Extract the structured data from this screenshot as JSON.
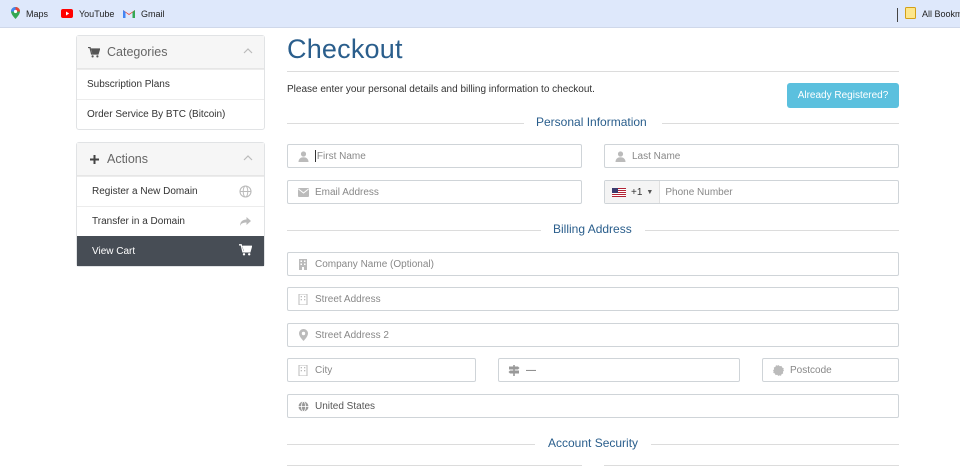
{
  "bookmarks": {
    "items": [
      {
        "label": "Maps",
        "icon": "maps-pin-icon"
      },
      {
        "label": "YouTube",
        "icon": "youtube-icon"
      },
      {
        "label": "Gmail",
        "icon": "gmail-icon"
      }
    ],
    "all_bookmarks": "All Bookm"
  },
  "sidebar": {
    "categories": {
      "title": "Categories",
      "items": [
        "Subscription Plans",
        "Order Service By BTC (Bitcoin)"
      ]
    },
    "actions": {
      "title": "Actions",
      "items": [
        "Register a New Domain",
        "Transfer in a Domain",
        "View Cart"
      ]
    }
  },
  "main": {
    "title": "Checkout",
    "intro": "Please enter your personal details and billing information to checkout.",
    "already_registered": "Already Registered?",
    "sections": {
      "personal": "Personal Information",
      "billing": "Billing Address",
      "security": "Account Security"
    },
    "fields": {
      "first_name": "First Name",
      "last_name": "Last Name",
      "email": "Email Address",
      "phone_code": "+1",
      "phone": "Phone Number",
      "company": "Company Name (Optional)",
      "street": "Street Address",
      "street2": "Street Address 2",
      "city": "City",
      "state": "—",
      "postcode": "Postcode",
      "country": "United States"
    }
  },
  "colors": {
    "accent": "#2a5e8c",
    "button": "#5bc0de",
    "active_item": "#474d55",
    "bookmark_bar": "#dee8fb"
  }
}
